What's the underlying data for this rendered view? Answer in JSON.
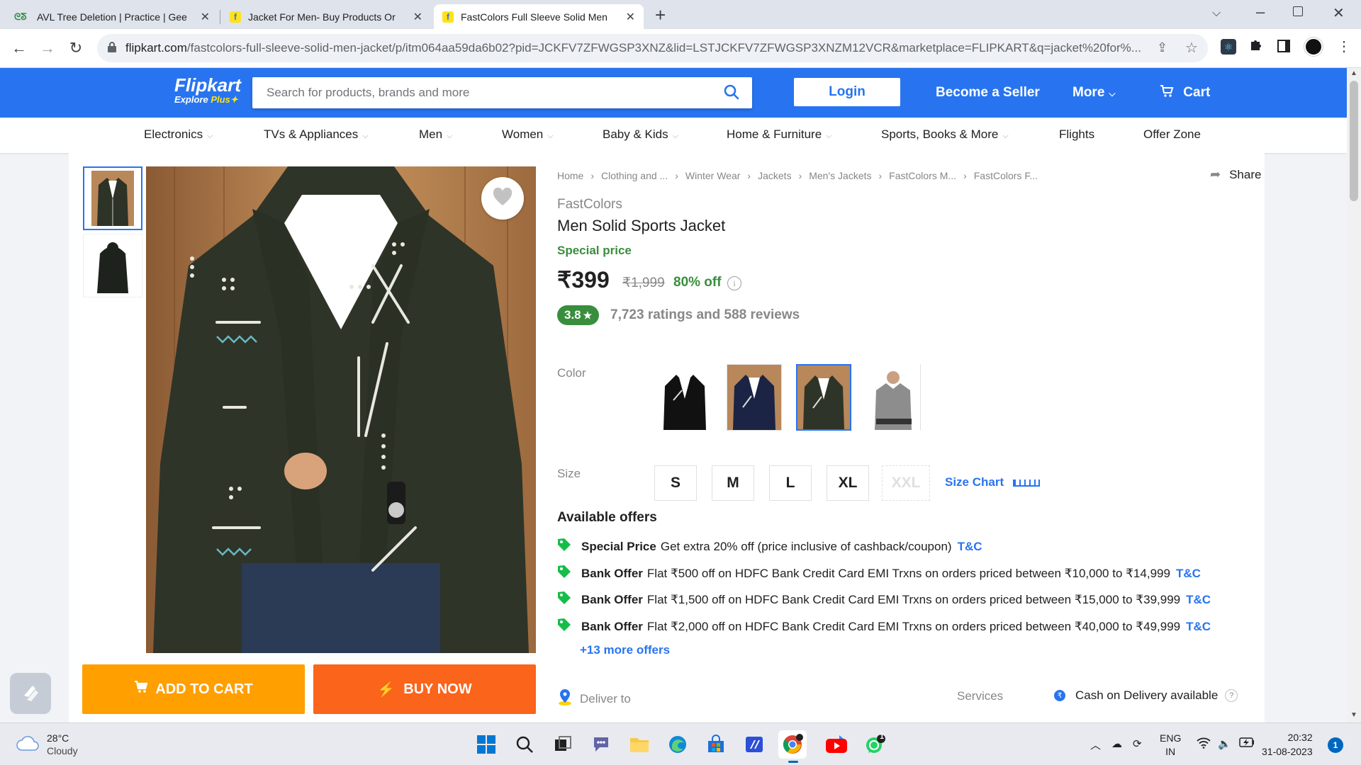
{
  "browser": {
    "tabs": [
      {
        "title": "AVL Tree Deletion | Practice | Gee",
        "active": false
      },
      {
        "title": "Jacket For Men- Buy Products Or",
        "active": false
      },
      {
        "title": "FastColors Full Sleeve Solid Men",
        "active": true
      }
    ],
    "url_host": "flipkart.com",
    "url_path": "/fastcolors-full-sleeve-solid-men-jacket/p/itm064aa59da6b02?pid=JCKFV7ZFWGSP3XNZ&lid=LSTJCKFV7ZFWGSP3XNZM12VCR&marketplace=FLIPKART&q=jacket%20for%..."
  },
  "header": {
    "logo": "Flipkart",
    "logo_sub_a": "Explore",
    "logo_sub_b": "Plus",
    "search_placeholder": "Search for products, brands and more",
    "login": "Login",
    "become_seller": "Become a Seller",
    "more": "More",
    "cart": "Cart"
  },
  "categories": [
    {
      "label": "Electronics",
      "chevron": true
    },
    {
      "label": "TVs & Appliances",
      "chevron": true
    },
    {
      "label": "Men",
      "chevron": true
    },
    {
      "label": "Women",
      "chevron": true
    },
    {
      "label": "Baby & Kids",
      "chevron": true
    },
    {
      "label": "Home & Furniture",
      "chevron": true
    },
    {
      "label": "Sports, Books & More",
      "chevron": true
    },
    {
      "label": "Flights",
      "chevron": false
    },
    {
      "label": "Offer Zone",
      "chevron": false
    }
  ],
  "breadcrumb": [
    "Home",
    "Clothing and ...",
    "Winter Wear",
    "Jackets",
    "Men's Jackets",
    "FastColors M...",
    "FastColors F..."
  ],
  "share": "Share",
  "product": {
    "brand": "FastColors",
    "title": "Men Solid Sports Jacket",
    "special_label": "Special price",
    "price": "₹399",
    "mrp": "₹1,999",
    "discount": "80% off",
    "rating": "3.8",
    "rating_star": "★",
    "ratings_text": "7,723 ratings and 588 reviews"
  },
  "color_label": "Color",
  "size_label": "Size",
  "sizes": [
    {
      "label": "S",
      "available": true
    },
    {
      "label": "M",
      "available": true
    },
    {
      "label": "L",
      "available": true
    },
    {
      "label": "XL",
      "available": true
    },
    {
      "label": "XXL",
      "available": false
    }
  ],
  "size_chart": "Size Chart",
  "offers_heading": "Available offers",
  "offers": [
    {
      "type": "Special Price",
      "text": "Get extra 20% off (price inclusive of cashback/coupon)",
      "tc": "T&C"
    },
    {
      "type": "Bank Offer",
      "text": "Flat ₹500 off on HDFC Bank Credit Card EMI Trxns on orders priced between ₹10,000 to ₹14,999",
      "tc": "T&C"
    },
    {
      "type": "Bank Offer",
      "text": "Flat ₹1,500 off on HDFC Bank Credit Card EMI Trxns on orders priced between ₹15,000 to ₹39,999",
      "tc": "T&C"
    },
    {
      "type": "Bank Offer",
      "text": "Flat ₹2,000 off on HDFC Bank Credit Card EMI Trxns on orders priced between ₹40,000 to ₹49,999",
      "tc": "T&C"
    }
  ],
  "more_offers": "+13 more offers",
  "deliver_to": "Deliver to",
  "services": "Services",
  "cod": "Cash on Delivery available",
  "cod_help": "?",
  "cta": {
    "add_to_cart": "ADD TO CART",
    "buy_now": "BUY NOW"
  },
  "taskbar": {
    "temp": "28°C",
    "weather": "Cloudy",
    "lang1": "ENG",
    "lang2": "IN",
    "time": "20:32",
    "date": "31-08-2023",
    "notif_count": "1",
    "whatsapp_badge": "1"
  },
  "colors": {
    "flipkart_blue": "#2874f0",
    "add_to_cart": "#ff9f00",
    "buy_now": "#fb641b",
    "green": "#388e3c"
  }
}
